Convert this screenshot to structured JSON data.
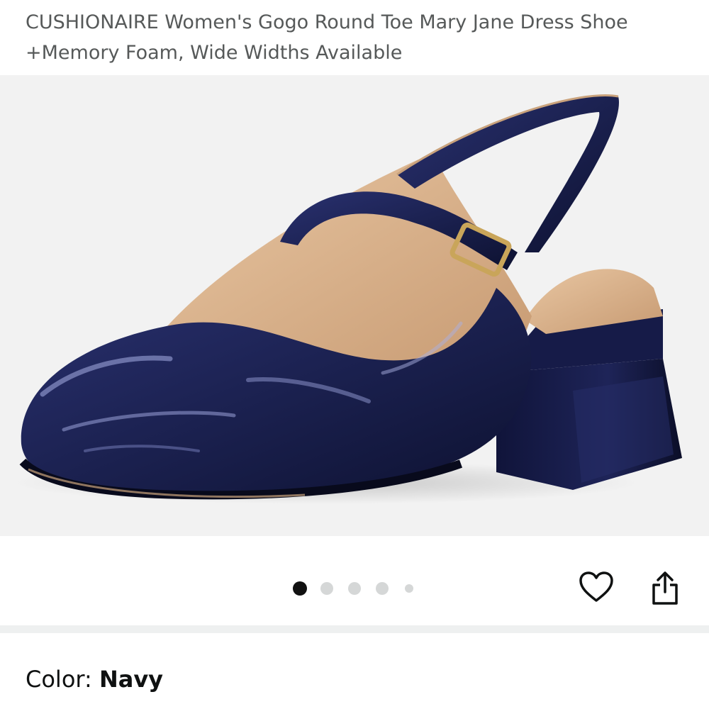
{
  "product": {
    "title": "CUSHIONAIRE Women's Gogo Round Toe Mary Jane Dress Shoe +Memory Foam, Wide Widths Available"
  },
  "gallery": {
    "dots_total": 5,
    "active_index": 0
  },
  "actions": {
    "favorite_icon": "heart-icon",
    "share_icon": "share-icon"
  },
  "variant": {
    "color_label": "Color: ",
    "color_value": "Navy"
  },
  "colors": {
    "shoe": "#1b2150",
    "background": "#f2f2f2"
  }
}
